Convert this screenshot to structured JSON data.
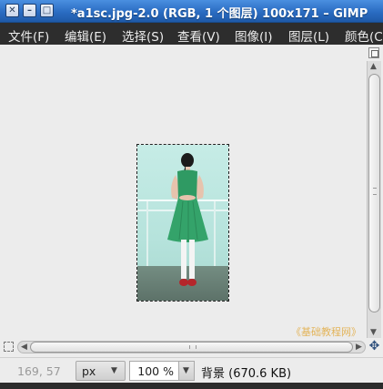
{
  "window": {
    "title": "*a1sc.jpg-2.0 (RGB, 1 个图层) 100x171 – GIMP",
    "buttons": {
      "close": "✕",
      "minimize": "–",
      "maximize": "□"
    }
  },
  "menubar": {
    "items": [
      {
        "label": "文件(F)"
      },
      {
        "label": "编辑(E)"
      },
      {
        "label": "选择(S)"
      },
      {
        "label": "查看(V)"
      },
      {
        "label": "图像(I)"
      },
      {
        "label": "图层(L)"
      },
      {
        "label": "颜色(C"
      }
    ]
  },
  "canvas": {
    "image_description_icon": "photo-girl-dancer"
  },
  "watermark": "《基础教程网》",
  "statusbar": {
    "coords": "169, 57",
    "unit": "px",
    "zoom": "100 %",
    "message": "背景 (670.6 KB)"
  },
  "colors": {
    "titlebar": "#2a6cc2",
    "menubar": "#2d2d2d",
    "workarea": "#ececec",
    "dress": "#2f9a63",
    "watermark": "#e3b45a"
  },
  "icons": {
    "navigate": "navigate-icon",
    "quick_mask": "quick-mask-icon",
    "move": "move-icon"
  }
}
